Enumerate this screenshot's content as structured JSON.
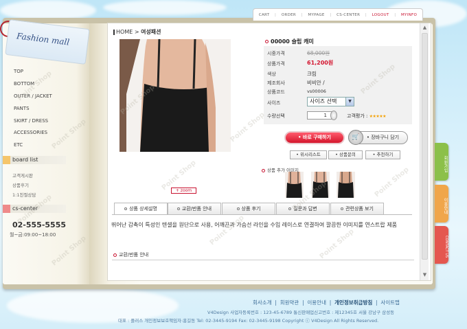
{
  "topnav": {
    "items": [
      "CART",
      "ORDER",
      "MYPAGE",
      "CS-CENTER",
      "LOGOUT",
      "MYINFO"
    ]
  },
  "logo": {
    "text": "Fashion mall"
  },
  "menu": {
    "items": [
      "TOP",
      "BOTTOM",
      "OUTER / JACKET",
      "PANTS",
      "SKIRT / DRESS",
      "ACCESSORIES",
      "ETC"
    ]
  },
  "board": {
    "title": "board list",
    "links": [
      "고객게시판",
      "상품후기",
      "1:1친절상담"
    ]
  },
  "cs": {
    "title": "cs-center",
    "phone": "02-555-5555",
    "hours": "월~금:09:00~18:00"
  },
  "breadcrumb": {
    "home": "HOME",
    "sep": ">",
    "current": "여성패션"
  },
  "product": {
    "title": "00000 슬립 캐미",
    "rows": [
      {
        "label": "시중가격",
        "value": "68,000원"
      },
      {
        "label": "상품가격",
        "value": "61,200원"
      },
      {
        "label": "색상",
        "value": "크림"
      },
      {
        "label": "제조회사",
        "value": "비비안   /"
      },
      {
        "label": "상품코드",
        "value": "vs00006"
      },
      {
        "label": "사이즈",
        "value": ""
      },
      {
        "label": "수량선택",
        "value": ""
      }
    ],
    "size_select": "사이즈 선택",
    "qty": "1",
    "rating_label": "고객평가 :",
    "stars": "★★★★★",
    "buy_button": "• 바로 구매하기",
    "cart_button": "• 장바구니 담기",
    "small_buttons": [
      "• 위시리스트",
      "• 상품문의",
      "• 추천하기"
    ],
    "extra_images_title": "상품 추가 이미지",
    "zoom": "+ zoom"
  },
  "tabs": [
    "상품 상세설명",
    "교환/반품 안내",
    "상품 후기",
    "질문과 답변",
    "관련상품 보기"
  ],
  "description": "뛰어난 감촉이 특성인 텐셀을 원단으로 사용, 어깨끈과 가슴선 라인을 수입 레이스로 연결하여 깔끔한 이미지를 연스트랍 제품",
  "exchange_title": "교환/반품 안내",
  "side_tabs": [
    "회원가입",
    "이용안내",
    "CONTACT US"
  ],
  "watermark": "Point Shop",
  "footer": {
    "links": [
      "회사소개",
      "회원약관",
      "이용안내",
      "개인정보취급방침",
      "사이트맵"
    ],
    "line2": "V4Design 사업자등록번호 : 123-45-6789 통신판매업신고번호 : 제12345호 서울 강남구 삼성동",
    "line3": "대표 : 플러스  개인정보보호책임자:홍길동 Tel: 02-3445-9194 Fax: 02-3445-9198 Copyright ⓒ V4Design All Rights Reserved."
  },
  "colors": {
    "accent_red": "#d3152f",
    "board_square": "#f5c56a",
    "cs_square": "#ef8a8a",
    "side_tab_green": "#8cc04a",
    "side_tab_orange": "#f0a64a",
    "side_tab_red": "#e4574f"
  }
}
